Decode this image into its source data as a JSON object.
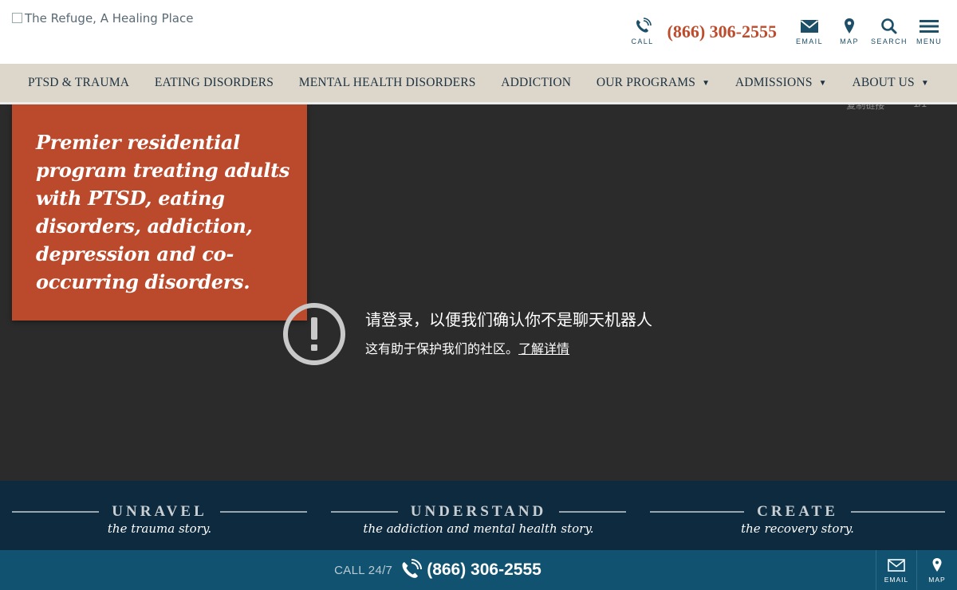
{
  "header": {
    "logo_alt": "The Refuge, A Healing Place",
    "call_label": "CALL",
    "phone": "(866) 306-2555",
    "email_label": "EMAIL",
    "map_label": "MAP",
    "search_label": "SEARCH",
    "menu_label": "MENU"
  },
  "nav": {
    "items": [
      {
        "label": "PTSD & TRAUMA"
      },
      {
        "label": "EATING DISORDERS"
      },
      {
        "label": "MENTAL HEALTH DISORDERS"
      },
      {
        "label": "ADDICTION"
      },
      {
        "label": "OUR PROGRAMS"
      },
      {
        "label": "ADMISSIONS"
      },
      {
        "label": "ABOUT US"
      }
    ],
    "caret": "▼"
  },
  "hero": {
    "promo_text": "Premier residential program treating adults with PTSD, eating disorders, addiction, depression and co-occurring disorders.",
    "top_partial": [
      "复制链接",
      "1/1"
    ],
    "notice_title": "请登录，以便我们确认你不是聊天机器人",
    "notice_body": "这有助于保护我们的社区。",
    "notice_link": "了解详情"
  },
  "taglines": [
    {
      "word": "UNRAVEL",
      "sub": "the trauma story."
    },
    {
      "word": "UNDERSTAND",
      "sub": "the addiction and mental health story."
    },
    {
      "word": "CREATE",
      "sub": "the recovery story."
    }
  ],
  "footer": {
    "call_247": "CALL 24/7",
    "phone": "(866) 306-2555",
    "email_label": "EMAIL",
    "map_label": "MAP"
  },
  "colors": {
    "accent": "#bb4a2d",
    "nav_bg": "#ddd6cb",
    "dark_navy": "#0d2a3e",
    "footer_blue": "#10526f"
  }
}
